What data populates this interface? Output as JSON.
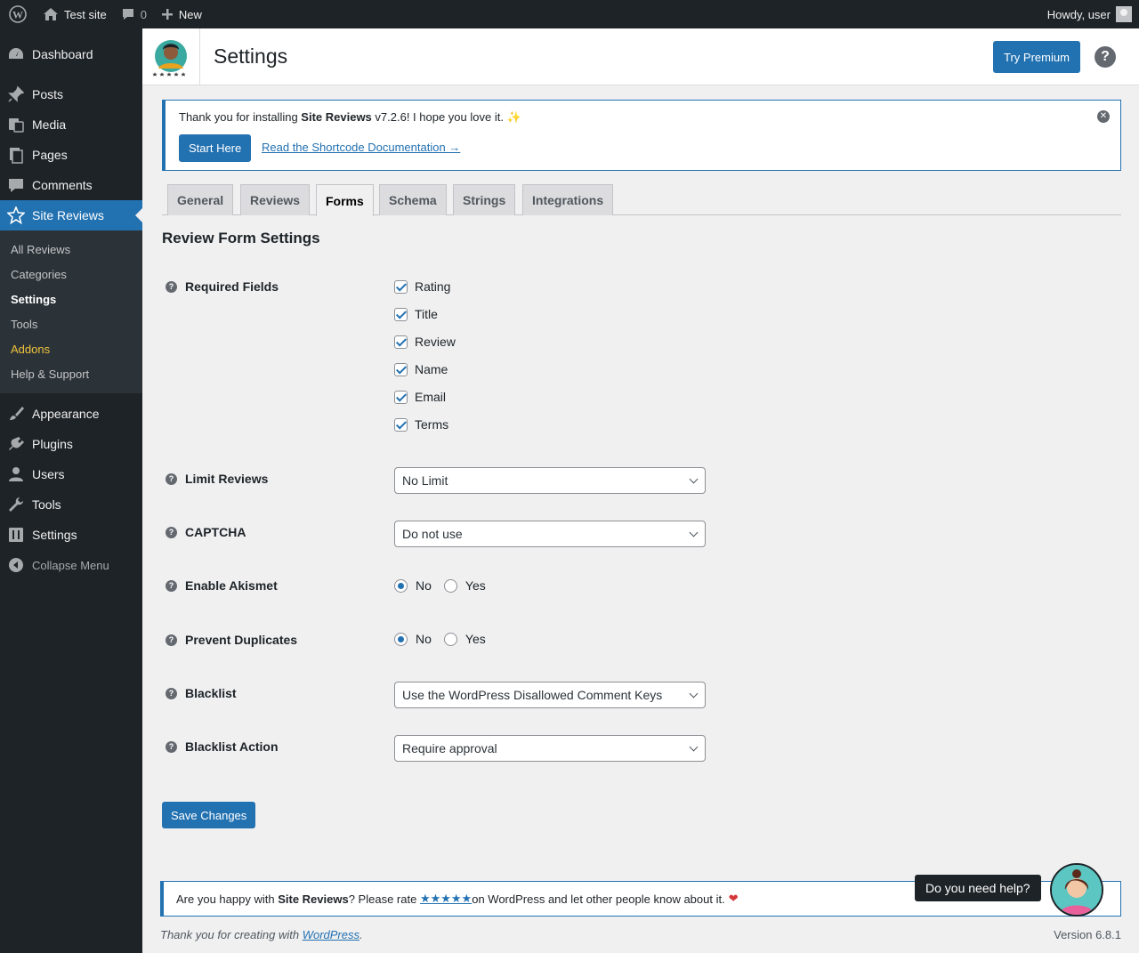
{
  "admin_bar": {
    "site_name": "Test site",
    "comments_count": "0",
    "new_label": "New",
    "greeting": "Howdy, user"
  },
  "sidebar": {
    "items_top": [
      {
        "label": "Dashboard",
        "icon": "dashboard-icon"
      },
      {
        "label": "Posts",
        "icon": "pin-icon"
      },
      {
        "label": "Media",
        "icon": "media-icon"
      },
      {
        "label": "Pages",
        "icon": "pages-icon"
      },
      {
        "label": "Comments",
        "icon": "comment-icon"
      },
      {
        "label": "Site Reviews",
        "icon": "star-icon"
      }
    ],
    "submenu": [
      "All Reviews",
      "Categories",
      "Settings",
      "Tools",
      "Addons",
      "Help & Support"
    ],
    "items_bottom": [
      {
        "label": "Appearance",
        "icon": "brush-icon"
      },
      {
        "label": "Plugins",
        "icon": "plug-icon"
      },
      {
        "label": "Users",
        "icon": "user-icon"
      },
      {
        "label": "Tools",
        "icon": "wrench-icon"
      },
      {
        "label": "Settings",
        "icon": "settings-icon"
      }
    ],
    "collapse_label": "Collapse Menu"
  },
  "header": {
    "title": "Settings",
    "premium_label": "Try Premium",
    "help_label": "?"
  },
  "notice": {
    "text_before": "Thank you for installing ",
    "plugin_name": "Site Reviews",
    "text_after": " v7.2.6! I hope you love it. ✨",
    "start_label": "Start Here",
    "doc_link": "Read the Shortcode Documentation →"
  },
  "tabs": [
    "General",
    "Reviews",
    "Forms",
    "Schema",
    "Strings",
    "Integrations"
  ],
  "active_tab": "Forms",
  "section_title": "Review Form Settings",
  "fields": {
    "required_label": "Required Fields",
    "required_options": [
      "Rating",
      "Title",
      "Review",
      "Name",
      "Email",
      "Terms"
    ],
    "limit_label": "Limit Reviews",
    "limit_value": "No Limit",
    "captcha_label": "CAPTCHA",
    "captcha_value": "Do not use",
    "akismet_label": "Enable Akismet",
    "duplicates_label": "Prevent Duplicates",
    "radio_no": "No",
    "radio_yes": "Yes",
    "blacklist_label": "Blacklist",
    "blacklist_value": "Use the WordPress Disallowed Comment Keys",
    "blacklist_action_label": "Blacklist Action",
    "blacklist_action_value": "Require approval"
  },
  "save_label": "Save Changes",
  "rate": {
    "before": "Are you happy with ",
    "name": "Site Reviews",
    "middle": "? Please rate ",
    "stars": "★★★★★",
    "after": " on WordPress and let other people know about it.",
    "heart": "❤"
  },
  "help_bubble": "Do you need help?",
  "footer": {
    "thanks_before": "Thank you for creating with ",
    "wp_link": "WordPress",
    "thanks_after": ".",
    "version": "Version 6.8.1"
  },
  "colors": {
    "accent": "#2271b1",
    "sidebar": "#1d2327",
    "addons": "#f0c33c"
  }
}
